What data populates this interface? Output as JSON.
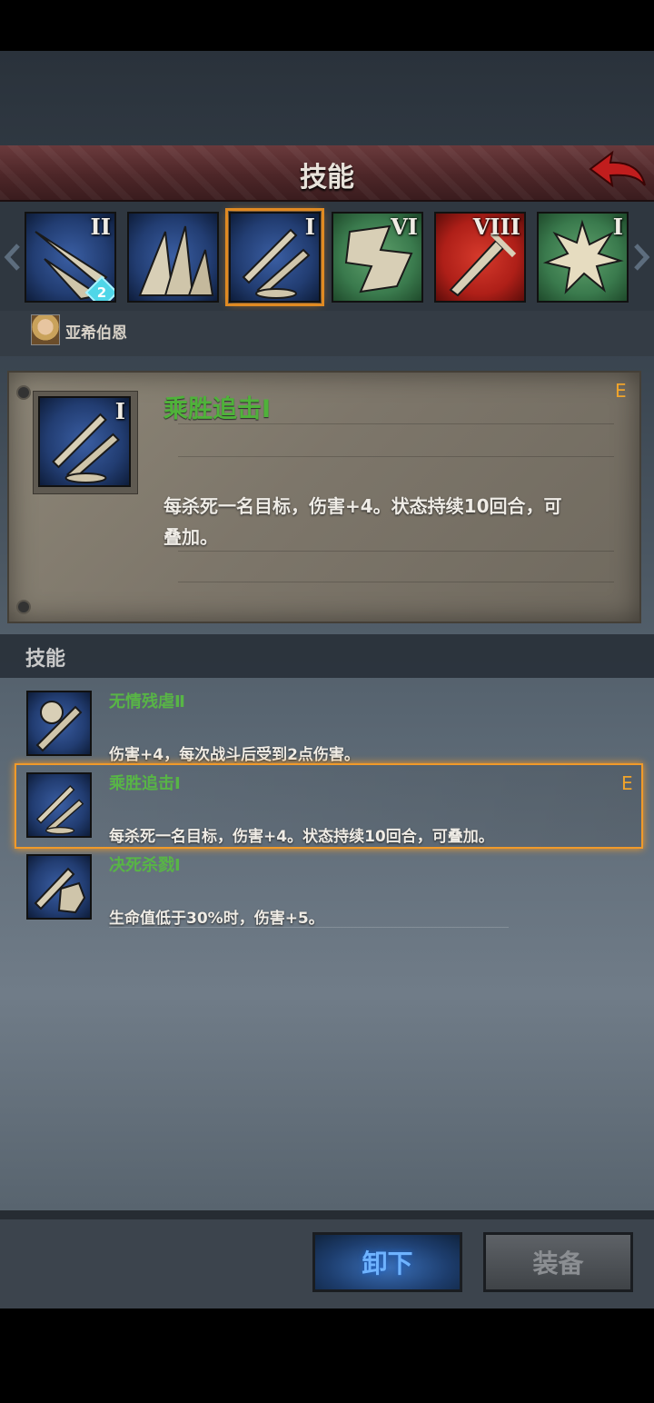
{
  "header": {
    "title": "技能"
  },
  "strip": {
    "slots": [
      {
        "level": "II",
        "color": "blue",
        "icon": "double-blade-icon",
        "badge": "2"
      },
      {
        "level": "",
        "color": "blue",
        "icon": "claw-slash-icon"
      },
      {
        "level": "I",
        "color": "blue",
        "icon": "crossed-swords-icon",
        "selected": true
      },
      {
        "level": "VI",
        "color": "green",
        "icon": "fist-strike-icon"
      },
      {
        "level": "VIII",
        "color": "red",
        "icon": "sword-icon"
      },
      {
        "level": "I",
        "color": "green",
        "icon": "burst-icon"
      }
    ]
  },
  "hero": {
    "name": "亚希伯恩"
  },
  "detail": {
    "name": "乘胜追击Ⅰ",
    "tag": "E",
    "description": "每杀死一名目标，伤害+4。状态持续10回合，可叠加。"
  },
  "skills": {
    "section_title": "技能",
    "items": [
      {
        "name": "无情残虐Ⅱ",
        "description": "伤害+4，每次战斗后受到2点伤害。",
        "icon": "brutal-sword-icon"
      },
      {
        "name": "乘胜追击Ⅰ",
        "description": "每杀死一名目标，伤害+4。状态持续10回合，可叠加。",
        "icon": "crossed-swords-icon",
        "tag": "E",
        "active": true
      },
      {
        "name": "决死杀戮Ⅰ",
        "description": "生命值低于30%时，伤害+5。",
        "icon": "fist-sword-icon"
      }
    ]
  },
  "buttons": {
    "unequip": "卸下",
    "equip": "装备"
  },
  "colors": {
    "accent_orange": "#f09a2a",
    "skill_name_green": "#58b546",
    "header_red": "#4d2628"
  }
}
